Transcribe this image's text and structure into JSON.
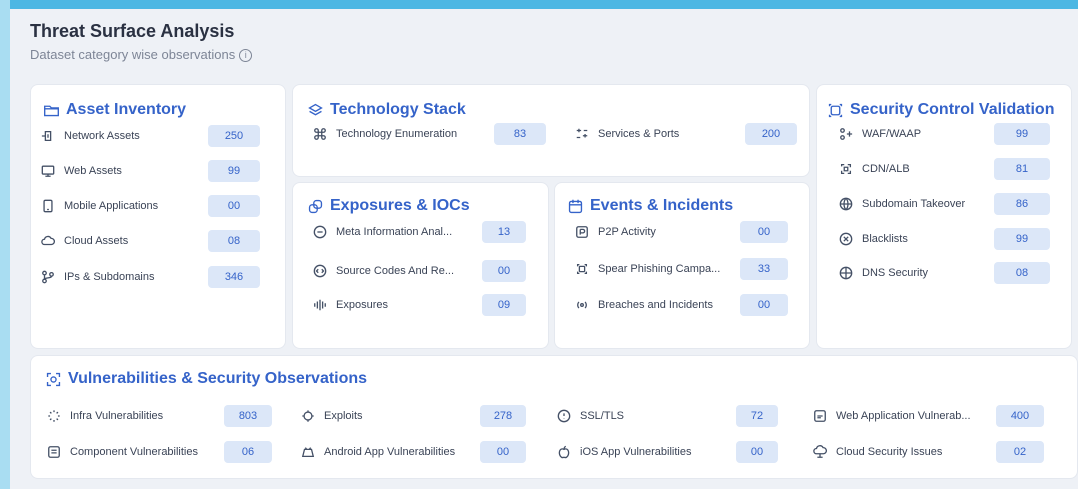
{
  "title": "Threat Surface Analysis",
  "subtitle": "Dataset category wise observations",
  "info_glyph": "i",
  "cards": {
    "asset_inventory": {
      "title": "Asset Inventory",
      "items": [
        {
          "label": "Network Assets",
          "value": "250",
          "icon": "network-icon"
        },
        {
          "label": "Web Assets",
          "value": "99",
          "icon": "monitor-icon"
        },
        {
          "label": "Mobile Applications",
          "value": "00",
          "icon": "mobile-icon"
        },
        {
          "label": "Cloud Assets",
          "value": "08",
          "icon": "cloud-icon"
        },
        {
          "label": "IPs & Subdomains",
          "value": "346",
          "icon": "ip-branch-icon"
        }
      ]
    },
    "technology_stack": {
      "title": "Technology Stack",
      "items": [
        {
          "label": "Technology Enumeration",
          "value": "83",
          "icon": "command-icon"
        },
        {
          "label": "Services & Ports",
          "value": "200",
          "icon": "ports-icon"
        }
      ]
    },
    "exposures_iocs": {
      "title": "Exposures & IOCs",
      "items": [
        {
          "label": "Meta Information Anal...",
          "value": "13",
          "icon": "meta-icon"
        },
        {
          "label": "Source Codes And Re...",
          "value": "00",
          "icon": "code-icon"
        },
        {
          "label": "Exposures",
          "value": "09",
          "icon": "signal-icon"
        }
      ]
    },
    "events_incidents": {
      "title": "Events & Incidents",
      "items": [
        {
          "label": "P2P Activity",
          "value": "00",
          "icon": "p2p-icon"
        },
        {
          "label": "Spear Phishing Campa...",
          "value": "33",
          "icon": "phishing-icon"
        },
        {
          "label": "Breaches and Incidents",
          "value": "00",
          "icon": "broadcast-icon"
        }
      ]
    },
    "security_control": {
      "title": "Security Control Validation",
      "items": [
        {
          "label": "WAF/WAAP",
          "value": "99",
          "icon": "waf-icon"
        },
        {
          "label": "CDN/ALB",
          "value": "81",
          "icon": "cdn-icon"
        },
        {
          "label": "Subdomain Takeover",
          "value": "86",
          "icon": "globe-icon"
        },
        {
          "label": "Blacklists",
          "value": "99",
          "icon": "blacklist-icon"
        },
        {
          "label": "DNS Security",
          "value": "08",
          "icon": "dns-icon"
        }
      ]
    },
    "vulnerabilities": {
      "title": "Vulnerabilities & Security Observations",
      "items": [
        {
          "label": "Infra Vulnerabilities",
          "value": "803",
          "icon": "infra-icon"
        },
        {
          "label": "Exploits",
          "value": "278",
          "icon": "bug-icon"
        },
        {
          "label": "SSL/TLS",
          "value": "72",
          "icon": "ssl-icon"
        },
        {
          "label": "Web Application Vulnerab...",
          "value": "400",
          "icon": "web-app-icon"
        },
        {
          "label": "Component Vulnerabilities",
          "value": "06",
          "icon": "component-icon"
        },
        {
          "label": "Android App Vulnerabilities",
          "value": "00",
          "icon": "android-icon"
        },
        {
          "label": "iOS App Vulnerabilities",
          "value": "00",
          "icon": "apple-icon"
        },
        {
          "label": "Cloud Security Issues",
          "value": "02",
          "icon": "cloud-security-icon"
        }
      ]
    }
  },
  "colors": {
    "accent": "#3563c9",
    "badge_bg": "#dce7f8",
    "panel_bg": "#eef1f6",
    "frame_top": "#4cb7e3"
  }
}
